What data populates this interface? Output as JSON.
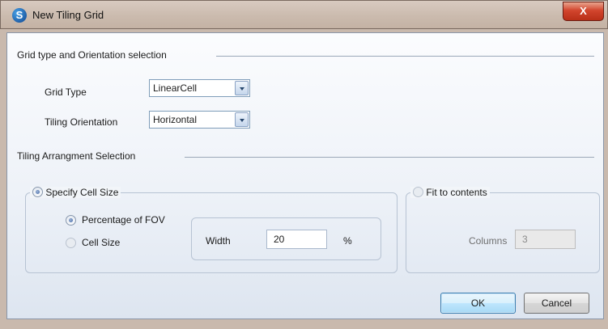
{
  "window": {
    "title": "New Tiling Grid",
    "close_label": "X"
  },
  "section1": {
    "heading": "Grid type and Orientation selection"
  },
  "grid_type": {
    "label": "Grid Type",
    "value": "LinearCell"
  },
  "tiling_orientation": {
    "label": "Tiling Orientation",
    "value": "Horizontal"
  },
  "section2": {
    "heading": "Tiling Arrangment Selection"
  },
  "specify_cell_size": {
    "label": "Specify Cell Size",
    "checked": true
  },
  "percentage_of_fov": {
    "label": "Percentage of FOV",
    "checked": true
  },
  "cell_size": {
    "label": "Cell Size",
    "checked": false
  },
  "width": {
    "label": "Width",
    "value": "20",
    "unit": "%"
  },
  "fit_to_contents": {
    "label": "Fit to contents",
    "checked": false
  },
  "columns": {
    "label": "Columns",
    "value": "3"
  },
  "buttons": {
    "ok": "OK",
    "cancel": "Cancel"
  }
}
